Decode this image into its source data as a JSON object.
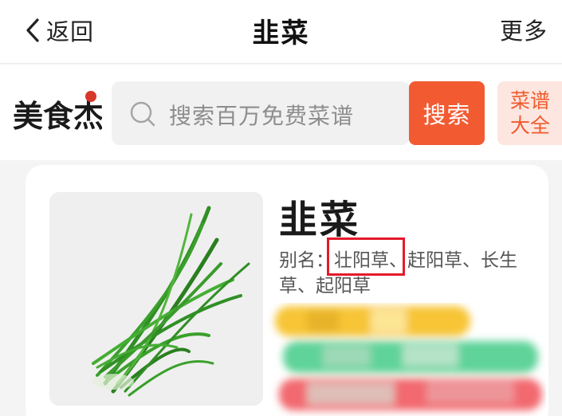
{
  "nav": {
    "back_label": "返回",
    "title": "韭菜",
    "more_label": "更多"
  },
  "logo": {
    "brand_text": "美食杰"
  },
  "search": {
    "placeholder": "搜索百万免费菜谱",
    "button_label": "搜索",
    "recipes_label_line1": "菜谱",
    "recipes_label_line2": "大全"
  },
  "item": {
    "title": "韭菜",
    "alias_label": "别名：",
    "alias_highlight": "壮阳草",
    "alias_rest": "、赶阳草、长生草、起阳草"
  },
  "colors": {
    "accent": "#f25b32",
    "highlight_box": "#e4192c",
    "recipes_bg": "#fde6df"
  }
}
